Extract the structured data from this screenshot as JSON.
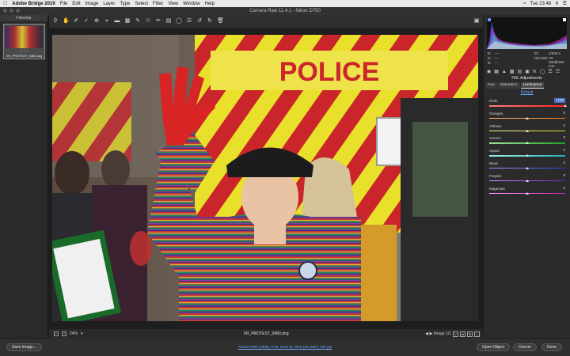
{
  "menubar": {
    "app": "Adobe Bridge 2019",
    "items": [
      "File",
      "Edit",
      "Image",
      "Layer",
      "Type",
      "Select",
      "Filter",
      "View",
      "Window",
      "Help"
    ],
    "clock": "Tue 23:48"
  },
  "window": {
    "title": "Camera Raw 11.4.1  -  Nikon D750"
  },
  "filmstrip": {
    "header": "Filmstrip",
    "filename": "XR_PROTEST_0480.dng"
  },
  "histogram": {
    "r_label": "R:",
    "g_label": "G:",
    "b_label": "B:",
    "r_val": "---",
    "g_val": "---",
    "b_val": "---",
    "aperture": "f/4",
    "shutter": "1/500 s",
    "iso": "ISO 500",
    "lens": "70-300@180 mm"
  },
  "panel": {
    "title": "HSL Adjustments",
    "tabs": [
      "Hue",
      "Saturation",
      "Luminance"
    ],
    "active_tab": "Luminance",
    "default_link": "Default",
    "sliders": [
      {
        "name": "Reds",
        "value": "+100",
        "position": 1.0,
        "highlight": true,
        "color_from": "#ff8080",
        "color_to": "#ff2020"
      },
      {
        "name": "Oranges",
        "value": "0",
        "position": 0.5,
        "highlight": false,
        "color_from": "#ffc080",
        "color_to": "#ff8020"
      },
      {
        "name": "Yellows",
        "value": "0",
        "position": 0.5,
        "highlight": false,
        "color_from": "#ffff90",
        "color_to": "#e0d020"
      },
      {
        "name": "Greens",
        "value": "0",
        "position": 0.5,
        "highlight": false,
        "color_from": "#a0e0a0",
        "color_to": "#20a020"
      },
      {
        "name": "Aquas",
        "value": "0",
        "position": 0.5,
        "highlight": false,
        "color_from": "#a0f0f0",
        "color_to": "#20b0b0"
      },
      {
        "name": "Blues",
        "value": "0",
        "position": 0.5,
        "highlight": false,
        "color_from": "#a0a0ff",
        "color_to": "#2040d0"
      },
      {
        "name": "Purples",
        "value": "0",
        "position": 0.5,
        "highlight": false,
        "color_from": "#d0a0ff",
        "color_to": "#7020c0"
      },
      {
        "name": "Magentas",
        "value": "0",
        "position": 0.5,
        "highlight": false,
        "color_from": "#ffa0ff",
        "color_to": "#d020b0"
      }
    ]
  },
  "bottombar": {
    "zoom": "24%",
    "filename": "XR_PROTEST_0480.dng",
    "image_count": "Image 1/1"
  },
  "preview": {
    "sign_text": "POLICE"
  },
  "footer": {
    "save_label": "Save Image...",
    "workflow": "Adobe RGB (1998); 8 bit; 6016 by 4016 (24.2MP); 300 ppi",
    "open_label": "Open Object",
    "cancel_label": "Cancel",
    "done_label": "Done"
  },
  "colors": {
    "accent": "#4a72c8",
    "link": "#6aa9ff"
  }
}
